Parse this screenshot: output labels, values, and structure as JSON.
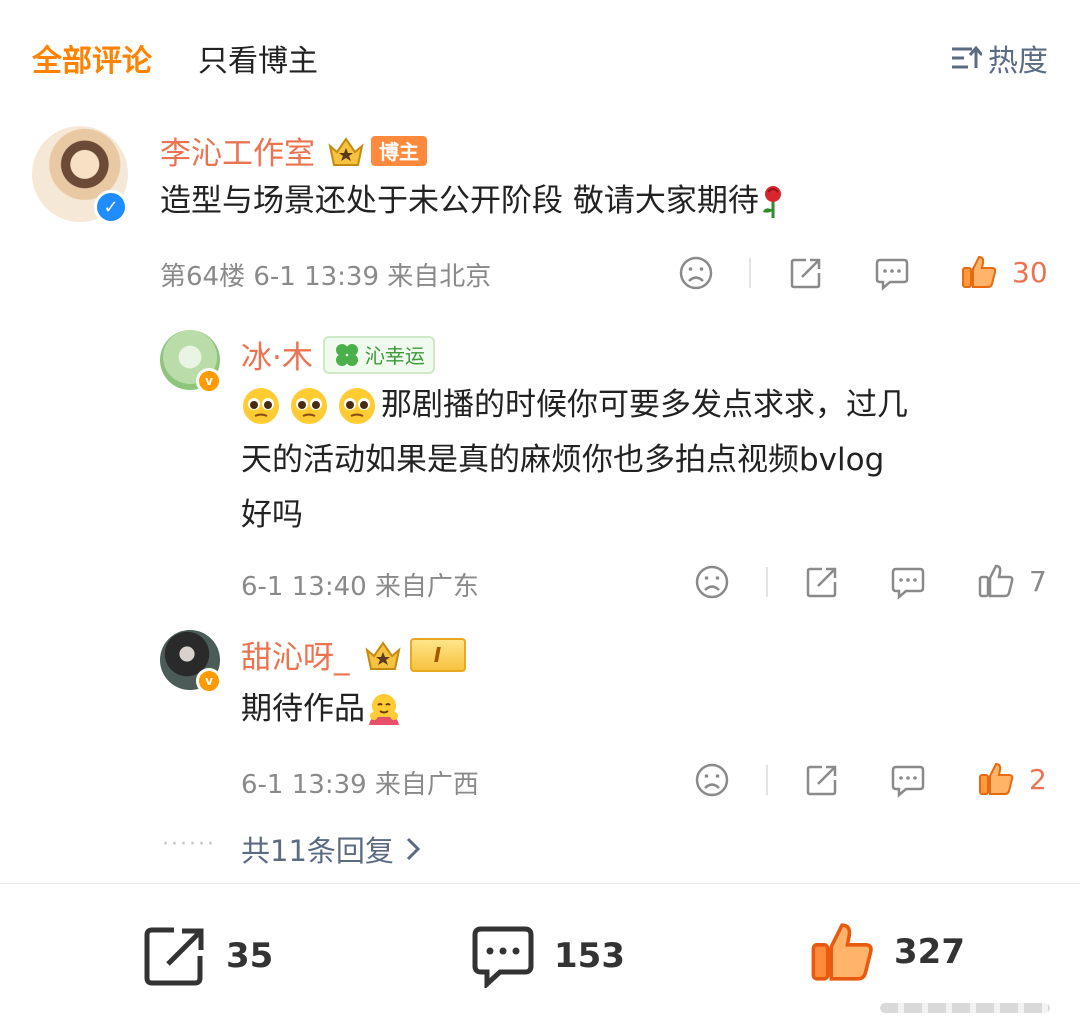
{
  "tabs": {
    "all_comments": "全部评论",
    "blogger_only": "只看博主",
    "sort_label": "热度"
  },
  "comments": [
    {
      "username": "李沁工作室",
      "badge": "博主",
      "content": "造型与场景还处于未公开阶段 敬请大家期待",
      "meta": "第64楼  6-1 13:39  来自北京",
      "likes": "30"
    }
  ],
  "replies": [
    {
      "username": "冰·木",
      "badge": "沁幸运",
      "content_line1": "那剧播的时候你可要多发点求求，过几",
      "content_line2": "天的活动如果是真的麻烦你也多拍点视频bvlog",
      "content_line3": "好吗",
      "meta": "6-1 13:40  来自广东",
      "likes": "7"
    },
    {
      "username": "甜沁呀_",
      "badge": "I",
      "content": "期待作品",
      "meta": "6-1 13:39  来自广西",
      "likes": "2"
    }
  ],
  "more_replies": "共11条回复",
  "bottom_bar": {
    "reposts": "35",
    "comments": "153",
    "likes": "327"
  },
  "icons": {
    "sort": "sort-icon",
    "dislike": "sad-face-icon",
    "share": "share-icon",
    "comment": "comment-icon",
    "like": "thumbs-up-icon",
    "rose": "rose-icon",
    "crown": "crown-icon",
    "clover": "clover-icon",
    "pleading": "pleading-face-icon",
    "hug": "hug-icon"
  },
  "colors": {
    "accent": "#ff8200",
    "username": "#eb7350",
    "meta": "#8a8a8a",
    "link": "#5b6b82",
    "verify_blue": "#1f8cff",
    "verify_orange": "#ff9a00"
  }
}
